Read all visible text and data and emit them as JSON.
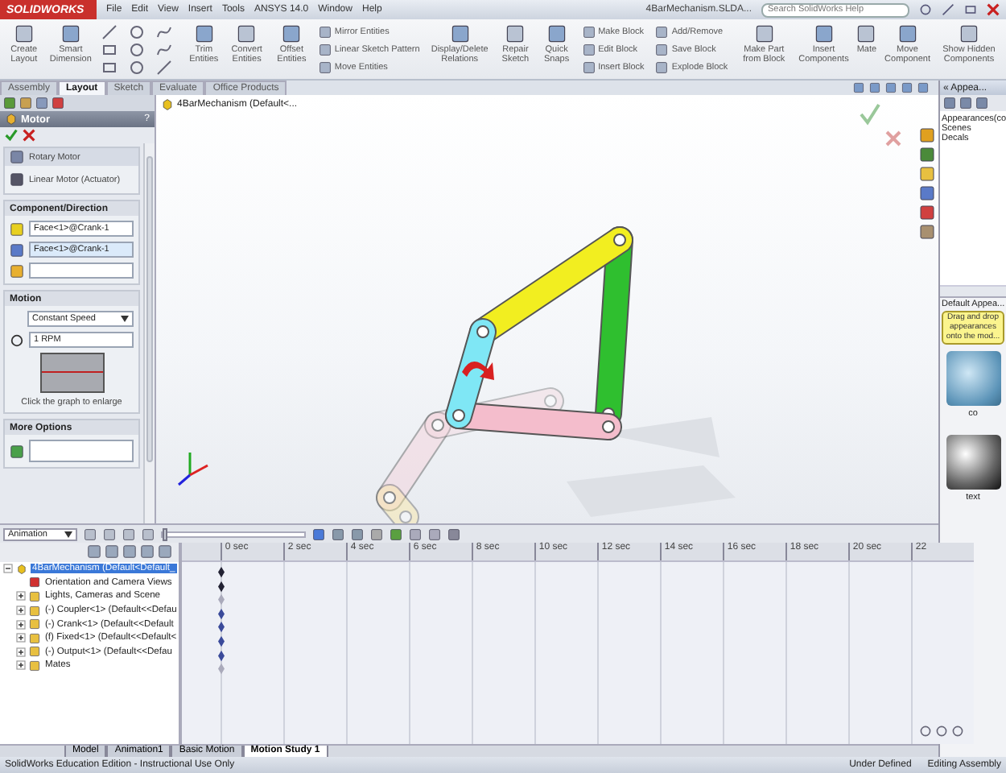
{
  "title_bar": {
    "logo": "SOLIDWORKS",
    "menu": [
      "File",
      "Edit",
      "View",
      "Insert",
      "Tools",
      "ANSYS 14.0",
      "Window",
      "Help"
    ],
    "document_title": "4BarMechanism.SLDA...",
    "search": {
      "placeholder": "Search SolidWorks Help"
    }
  },
  "ribbon": [
    {
      "kind": "large",
      "label": "Create Layout"
    },
    {
      "kind": "large",
      "label": "Smart Dimension"
    },
    {
      "kind": "sketch_tools"
    },
    {
      "kind": "large",
      "label": "Trim Entities"
    },
    {
      "kind": "large",
      "label": "Convert Entities"
    },
    {
      "kind": "large",
      "label": "Offset Entities"
    },
    {
      "kind": "stack",
      "items": [
        "Mirror Entities",
        "Linear Sketch Pattern",
        "Move Entities"
      ]
    },
    {
      "kind": "large",
      "label": "Display/Delete Relations"
    },
    {
      "kind": "large",
      "label": "Repair Sketch"
    },
    {
      "kind": "large",
      "label": "Quick Snaps"
    },
    {
      "kind": "stack",
      "items": [
        "Make Block",
        "Edit Block",
        "Insert Block"
      ]
    },
    {
      "kind": "stack",
      "items": [
        "Add/Remove",
        "Save Block",
        "Explode Block"
      ]
    },
    {
      "kind": "large",
      "label": "Make Part from Block"
    },
    {
      "kind": "large",
      "label": "Insert Components"
    },
    {
      "kind": "large",
      "label": "Mate"
    },
    {
      "kind": "large",
      "label": "Move Component"
    },
    {
      "kind": "large",
      "label": "Show Hidden Components"
    }
  ],
  "command_tabs": [
    {
      "label": "Assembly",
      "selected": false
    },
    {
      "label": "Layout",
      "selected": true
    },
    {
      "label": "Sketch",
      "selected": false
    },
    {
      "label": "Evaluate",
      "selected": false
    },
    {
      "label": "Office Products",
      "selected": false
    }
  ],
  "property_manager": {
    "title": "Motor",
    "help": "?",
    "motor_types": [
      {
        "label": "Rotary Motor",
        "selected": true
      },
      {
        "label": "Linear Motor (Actuator)",
        "selected": false
      }
    ],
    "component_direction": {
      "title": "Component/Direction",
      "fields": [
        {
          "value": "Face<1>@Crank-1",
          "selected": false
        },
        {
          "value": "Face<1>@Crank-1",
          "selected": true
        },
        {
          "selected": false
        }
      ]
    },
    "motion": {
      "title": "Motion",
      "type": "Constant Speed",
      "speed": "1 RPM",
      "caption": "Click the graph to enlarge"
    },
    "more_options": {
      "title": "More Options"
    }
  },
  "graphics": {
    "tree_root": "4BarMechanism  (Default<..."
  },
  "task_pane": {
    "title": "« Appea...",
    "tree": [
      "Appearances(co",
      "Scenes",
      "Decals"
    ],
    "section": "Default Appea...",
    "tip": "Drag and drop appearances onto the mod...",
    "thumbnails": [
      "co",
      "text"
    ]
  },
  "motion_manager": {
    "study_type": "Animation",
    "playback": {
      "level": 0
    },
    "tree": [
      {
        "label": "4BarMechanism  (Default<Default_",
        "selected": true,
        "expanded": true,
        "children": [
          {
            "label": "Orientation and Camera Views",
            "selected": false
          },
          {
            "label": "Lights, Cameras and Scene",
            "selected": false,
            "expanded": false
          },
          {
            "label": "(-) Coupler<1> (Default<<Defau",
            "selected": false,
            "expanded": false
          },
          {
            "label": "(-) Crank<1> (Default<<Default",
            "selected": false,
            "expanded": false
          },
          {
            "label": "(f) Fixed<1> (Default<<Default<",
            "selected": false,
            "expanded": false
          },
          {
            "label": "(-) Output<1> (Default<<Defau",
            "selected": false,
            "expanded": false
          },
          {
            "label": "Mates",
            "selected": false,
            "expanded": false
          }
        ]
      }
    ],
    "times": [
      "0 sec",
      "2 sec",
      "4 sec",
      "6 sec",
      "8 sec",
      "10 sec",
      "12 sec",
      "14 sec",
      "16 sec",
      "18 sec",
      "20 sec",
      "22"
    ]
  },
  "bottom_tabs": [
    {
      "label": "Model",
      "selected": false
    },
    {
      "label": "Animation1",
      "selected": false
    },
    {
      "label": "Basic Motion",
      "selected": false
    },
    {
      "label": "Motion Study 1",
      "selected": true
    }
  ],
  "status_bar": {
    "edition": "SolidWorks Education Edition - Instructional Use Only",
    "state": "Under Defined",
    "mode": "Editing Assembly"
  }
}
